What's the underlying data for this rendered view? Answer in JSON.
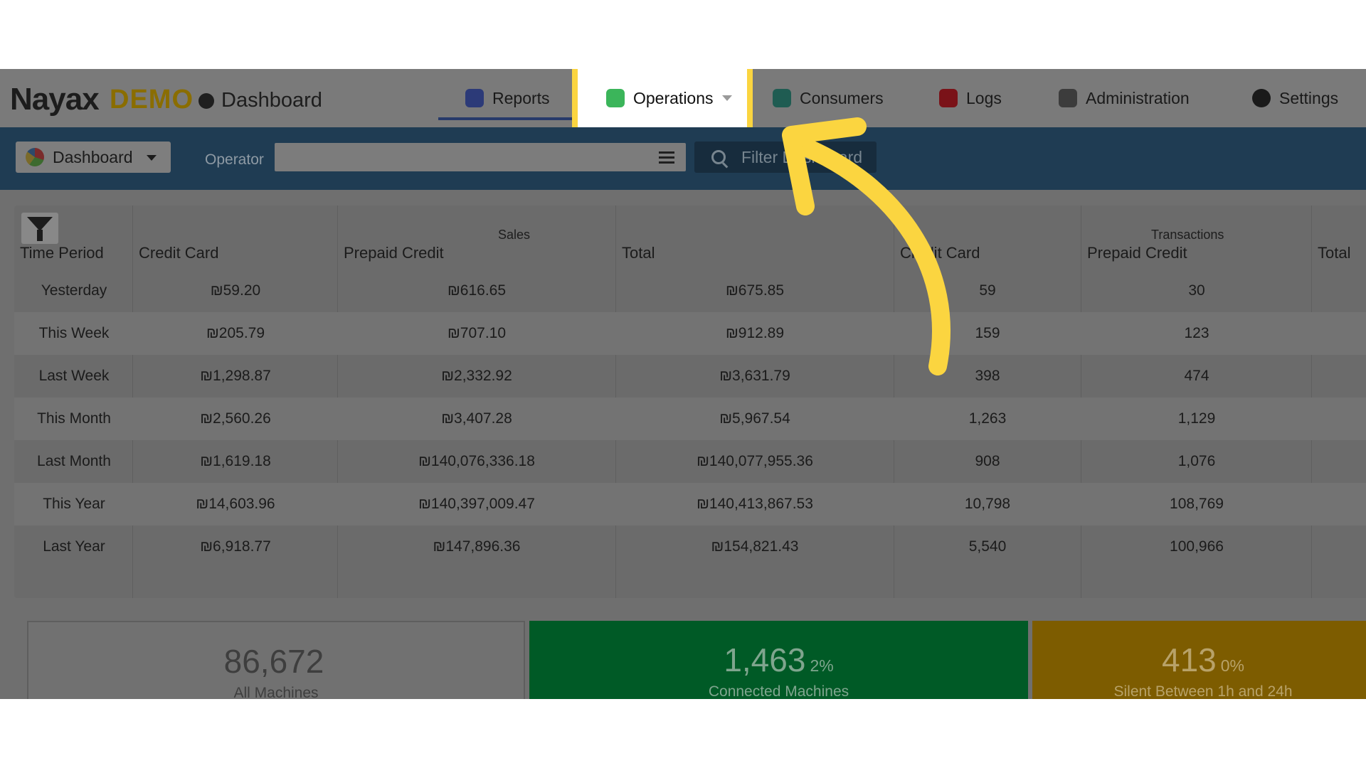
{
  "app": {
    "logo": "Nayax",
    "logo_badge": "DEMO",
    "section": "Dashboard"
  },
  "nav": {
    "reports": "Reports",
    "operations": "Operations",
    "consumers": "Consumers",
    "logs": "Logs",
    "administration": "Administration",
    "settings": "Settings"
  },
  "filter_bar": {
    "dashboard_select": "Dashboard",
    "operator_label": "Operator",
    "operator_value": "",
    "filter_button": "Filter Dashboard"
  },
  "table": {
    "group_sales": "Sales",
    "group_transactions": "Transactions",
    "headers": [
      "Time Period",
      "Credit Card",
      "Prepaid Credit",
      "Total",
      "Credit Card",
      "Prepaid Credit",
      "Total"
    ],
    "rows": [
      [
        "Yesterday",
        "₪59.20",
        "₪616.65",
        "₪675.85",
        "59",
        "30",
        ""
      ],
      [
        "This Week",
        "₪205.79",
        "₪707.10",
        "₪912.89",
        "159",
        "123",
        ""
      ],
      [
        "Last Week",
        "₪1,298.87",
        "₪2,332.92",
        "₪3,631.79",
        "398",
        "474",
        ""
      ],
      [
        "This Month",
        "₪2,560.26",
        "₪3,407.28",
        "₪5,967.54",
        "1,263",
        "1,129",
        ""
      ],
      [
        "Last Month",
        "₪1,619.18",
        "₪140,076,336.18",
        "₪140,077,955.36",
        "908",
        "1,076",
        ""
      ],
      [
        "This Year",
        "₪14,603.96",
        "₪140,397,009.47",
        "₪140,413,867.53",
        "10,798",
        "108,769",
        ""
      ],
      [
        "Last Year",
        "₪6,918.77",
        "₪147,896.36",
        "₪154,821.43",
        "5,540",
        "100,966",
        ""
      ]
    ]
  },
  "cards": [
    {
      "value": "86,672",
      "percent": "",
      "label": "All Machines"
    },
    {
      "value": "1,463",
      "percent": "2%",
      "label": "Connected Machines"
    },
    {
      "value": "413",
      "percent": "0%",
      "label": "Silent Between 1h and 24h"
    }
  ],
  "colors": {
    "highlight": "#fbd540",
    "header_bar": "#1f3c53",
    "card_connected": "#005a26",
    "card_silent": "#7d5c00"
  }
}
